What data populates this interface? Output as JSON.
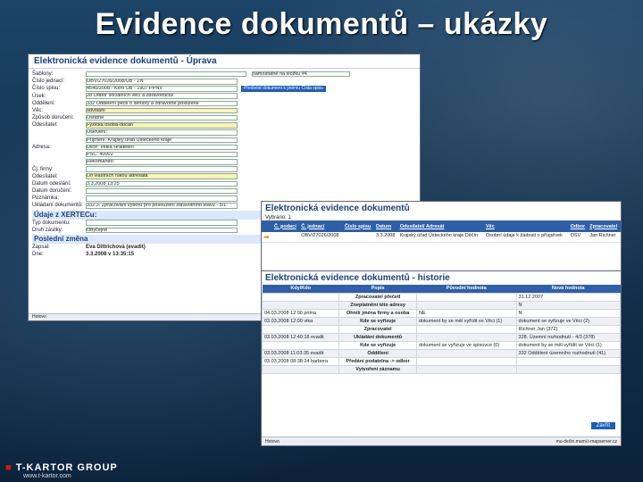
{
  "slide": {
    "title": "Evidence dokumentů – ukázky",
    "logo": "T-KARTOR GROUP",
    "website": "www.t-kartor.com"
  },
  "form": {
    "title": "Elektronická evidence dokumentů - Úprava",
    "rows": [
      {
        "label": "Šablony:",
        "value": ""
      },
      {
        "label": "Číslo jednací:",
        "value": "OBV/27026/2008/UB - ZN"
      },
      {
        "label": "Číslo spisu:",
        "value": "4540/2008 - Kéní UB - 1907 PPNV"
      },
      {
        "label": "Úsek:",
        "value": "28 Odbor sociálních věcí a zdravotnictví"
      },
      {
        "label": "Oddělení:",
        "value": "332 Oddělení péče o seniory a zdravotně postižené"
      },
      {
        "label": "Věc:",
        "value": "odvolání"
      },
      {
        "label": "Způsob doručení:",
        "value": "Osobně"
      },
      {
        "label": "Odesílatel:",
        "value": "Fyzická osoba-občan"
      },
      {
        "label": "",
        "value": "Oslovení:"
      },
      {
        "label": "",
        "value": "Příjmení: Krajský úřad Ústeckého kraje"
      },
      {
        "label": "Adresa:",
        "value": "Ulice: Velká Hradební"
      },
      {
        "label": "",
        "value": "PSČ: 40002"
      },
      {
        "label": "",
        "value": "Rekomando:"
      },
      {
        "label": "Čj. firmy:",
        "value": ""
      },
      {
        "label": "Odesílatel:",
        "value": "Do vlastních rukou adresáta"
      },
      {
        "label": "Datum odeslání:",
        "value": "3.3.2008 13:25"
      },
      {
        "label": "Datum doručení:",
        "value": ""
      },
      {
        "label": "Poznámka:",
        "value": ""
      },
      {
        "label": "Ukládaní dokumentů:",
        "value": "332.3. Zpracování výboru pro posouzení zdravotního stavu - 5/1"
      }
    ],
    "section1": "Údaje z XERTECu:",
    "section1_rows": [
      {
        "label": "Typ dokumentu:",
        "value": ""
      },
      {
        "label": "Druh zásilky:",
        "value": "Obyčejné"
      }
    ],
    "section2": "Poslední změna",
    "section2_rows": [
      {
        "label": "Zapsal:",
        "value": "Eva Dittrichová (evadit)"
      },
      {
        "label": "Dne:",
        "value": "3.3.2008 v 13:35:15"
      }
    ],
    "save_button": "Předvést dokument k jinému Čísla spisu",
    "template_select": "samostatné na složku #4",
    "footer": "Hotovo"
  },
  "list": {
    "title": "Elektronická evidence dokumentů",
    "subtitle": "Vybráno: 1",
    "headers": [
      "Č. podací",
      "Č. jednací",
      "Číslo spisu",
      "Datum",
      "Odesílatel/ Adresát",
      "Věc",
      "Odbor",
      "Zpracovatel"
    ],
    "row": [
      "",
      "OBV/27026/2008",
      "",
      "3.3.2008",
      "Krajský úřad Ústeckého kraje Děčín",
      "Osobní údaje k žádosti o příspěvek",
      "OSV",
      "Jan Richner"
    ]
  },
  "history": {
    "title": "Elektronická evidence dokumentů - historie",
    "headers": [
      "Kdy/Kdo",
      "Popis",
      "Původní hodnota",
      "Nová hodnota"
    ],
    "rows": [
      [
        "",
        "Zpracovatel přečetl",
        "",
        "31.12.2007"
      ],
      [
        "",
        "Zneplatnění této adresy",
        "",
        "N"
      ],
      [
        "04.03.2008 12:00 prima",
        "Ohnilí jména firmy a osoba",
        "NE",
        "N"
      ],
      [
        "03.03.2008 12:00 vika",
        "Kde se vyřizuje",
        "dokument by se měl vyřídit ve Věci (1)",
        "dokument se vyřizuje ve Věci (2)"
      ],
      [
        "",
        "Zpracovatel",
        "",
        "Richner Jan (372)"
      ],
      [
        "03.03.2008 12:40:18 evadit",
        "Ukládání dokumentů",
        "",
        "328. Územní rozhodnutí - 4/3 (378)"
      ],
      [
        "",
        "Kde se vyřizuje",
        "dokument se vyřizuje ve spisovce (0)",
        "dokument by se měl vyřídit ve Věci (1)"
      ],
      [
        "03.03.2008 11:03:35 evadit",
        "Oddělení",
        "",
        "332 Oddělení územního rozhodnutí (41)"
      ],
      [
        "03.03.2008 08:38:24 barbora",
        "Předání podatelna -> odbor",
        "",
        ""
      ],
      [
        "",
        "Vytvoření záznamu",
        "",
        ""
      ]
    ],
    "close_button": "Zavřít",
    "footer_left": "Hotovo",
    "footer_right": "mu-dečin.mumi.t-mapserver.cz"
  }
}
